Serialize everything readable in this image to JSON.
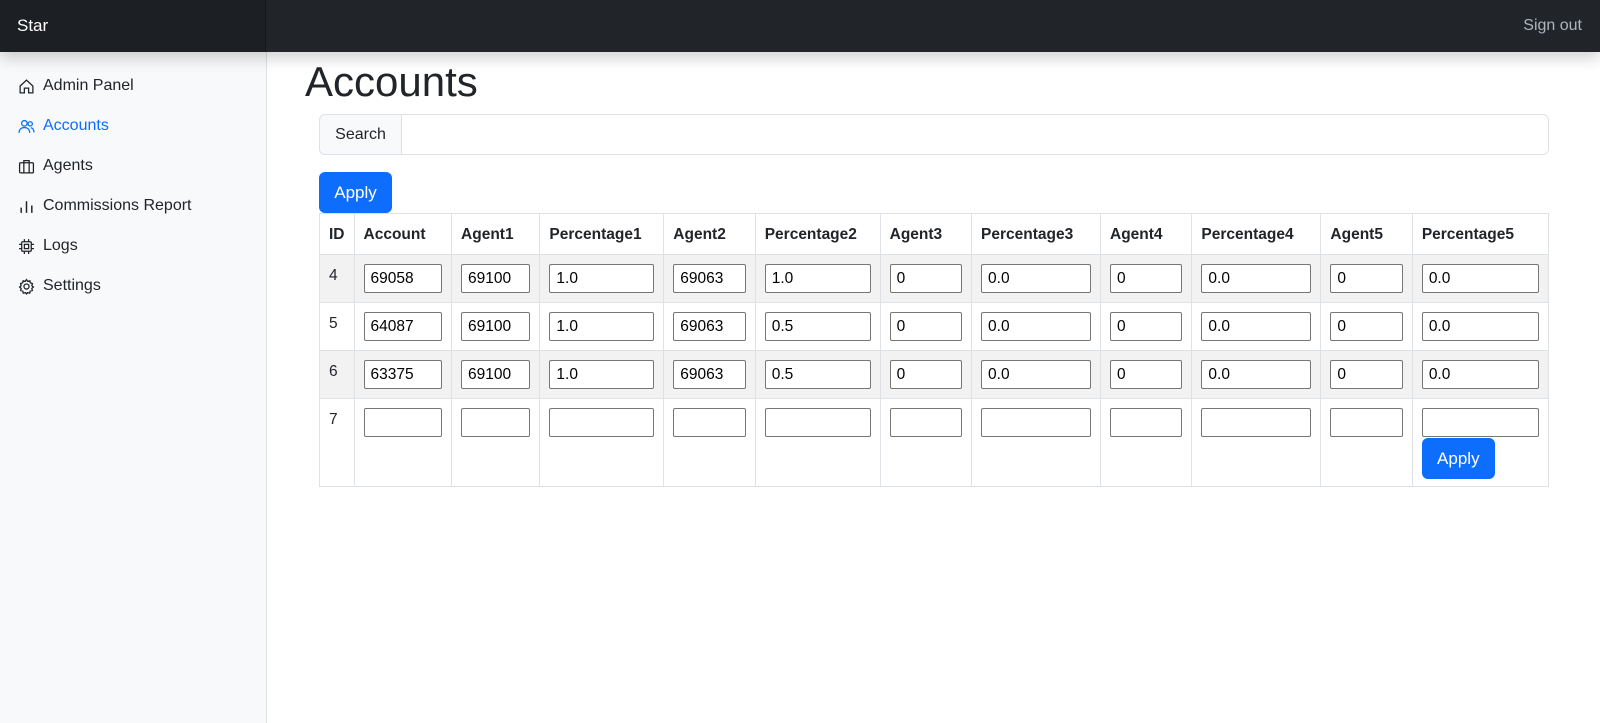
{
  "navbar": {
    "brand": "Star",
    "sign_out": "Sign out"
  },
  "sidebar": {
    "items": [
      {
        "label": "Admin Panel",
        "icon": "house-icon",
        "active": false
      },
      {
        "label": "Accounts",
        "icon": "people-icon",
        "active": true
      },
      {
        "label": "Agents",
        "icon": "briefcase-icon",
        "active": false
      },
      {
        "label": "Commissions Report",
        "icon": "bar-chart-icon",
        "active": false
      },
      {
        "label": "Logs",
        "icon": "cpu-icon",
        "active": false
      },
      {
        "label": "Settings",
        "icon": "gear-icon",
        "active": false
      }
    ]
  },
  "main": {
    "title": "Accounts",
    "search": {
      "label": "Search",
      "value": ""
    },
    "apply_label": "Apply",
    "row_apply_label": "Apply"
  },
  "table": {
    "headers": [
      "ID",
      "Account",
      "Agent1",
      "Percentage1",
      "Agent2",
      "Percentage2",
      "Agent3",
      "Percentage3",
      "Agent4",
      "Percentage4",
      "Agent5",
      "Percentage5"
    ],
    "rows": [
      {
        "id": "4",
        "values": [
          "69058",
          "69100",
          "1.0",
          "69063",
          "1.0",
          "0",
          "0.0",
          "0",
          "0.0",
          "0",
          "0.0"
        ]
      },
      {
        "id": "5",
        "values": [
          "64087",
          "69100",
          "1.0",
          "69063",
          "0.5",
          "0",
          "0.0",
          "0",
          "0.0",
          "0",
          "0.0"
        ]
      },
      {
        "id": "6",
        "values": [
          "63375",
          "69100",
          "1.0",
          "69063",
          "0.5",
          "0",
          "0.0",
          "0",
          "0.0",
          "0",
          "0.0"
        ]
      },
      {
        "id": "7",
        "values": [
          "",
          "",
          "",
          "",
          "",
          "",
          "",
          "",
          "",
          "",
          ""
        ]
      }
    ]
  },
  "colors": {
    "accent": "#0d6efd",
    "navbar": "#212529",
    "sidebar": "#f8f9fa",
    "row_stripe": "#f2f2f2"
  }
}
